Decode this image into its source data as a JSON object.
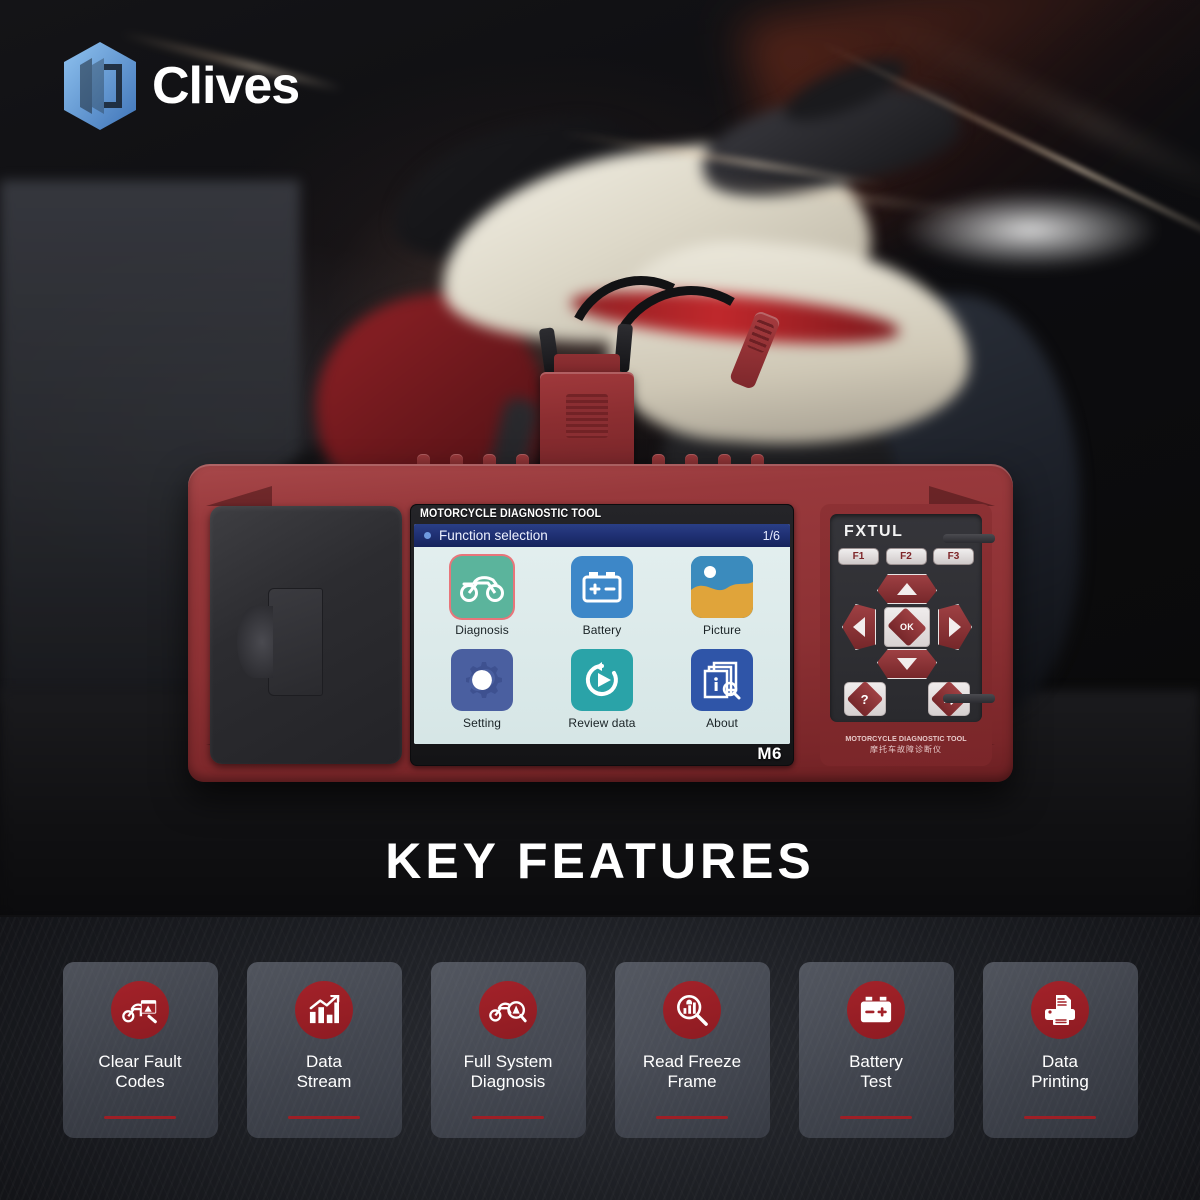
{
  "brand": {
    "logo_text": "Clives",
    "logo_icon": "hexagon-c-logo-icon",
    "logo_color": "#7fb6e8"
  },
  "hero": {
    "scene": "blurred red and white sport motorcycle in dark garage",
    "heading": "KEY FEATURES"
  },
  "device": {
    "model_label": "M6",
    "bezel_caption": "MOTORCYCLE DIAGNOSTIC TOOL",
    "body_color": "#8d3134",
    "keypad": {
      "brand": "FXTUL",
      "function_keys": [
        "F1",
        "F2",
        "F3"
      ],
      "ok_label": "OK",
      "dpad": [
        "up",
        "left",
        "right",
        "down"
      ],
      "bottom_buttons": [
        "help-button",
        "return-button"
      ],
      "caption_en": "MOTORCYCLE DIAGNOSTIC TOOL",
      "caption_cn": "摩托车故障诊断仪"
    },
    "screen": {
      "title": "Function selection",
      "page_indicator": "1/6",
      "title_bar_color": "#203175",
      "apps": [
        {
          "label": "Diagnosis",
          "icon": "motorcycle-icon",
          "color": "#5bb49c",
          "selected": true
        },
        {
          "label": "Battery",
          "icon": "battery-icon",
          "color": "#3d87c8",
          "selected": false
        },
        {
          "label": "Picture",
          "icon": "picture-icon",
          "color": "#e0a43a",
          "selected": false
        },
        {
          "label": "Setting",
          "icon": "gear-icon",
          "color": "#4a5fa0",
          "selected": false
        },
        {
          "label": "Review data",
          "icon": "replay-play-icon",
          "color": "#2aa3a8",
          "selected": false
        },
        {
          "label": "About",
          "icon": "documents-info-icon",
          "color": "#2f55a8",
          "selected": false
        }
      ]
    },
    "accessories": {
      "connector": "obd-connector-plug",
      "cables": "black-test-leads",
      "probe_end": "red-banana-connector"
    }
  },
  "features": {
    "accent_color": "#9e1f26",
    "cards": [
      {
        "label": "Clear Fault\nCodes",
        "icon": "motorcycle-clear-codes-icon"
      },
      {
        "label": "Data\nStream",
        "icon": "bar-chart-trend-icon"
      },
      {
        "label": "Full System\nDiagnosis",
        "icon": "motorcycle-scan-warning-icon"
      },
      {
        "label": "Read Freeze\nFrame",
        "icon": "magnifier-chart-icon"
      },
      {
        "label": "Battery\nTest",
        "icon": "battery-icon"
      },
      {
        "label": "Data\nPrinting",
        "icon": "printer-icon"
      }
    ]
  }
}
